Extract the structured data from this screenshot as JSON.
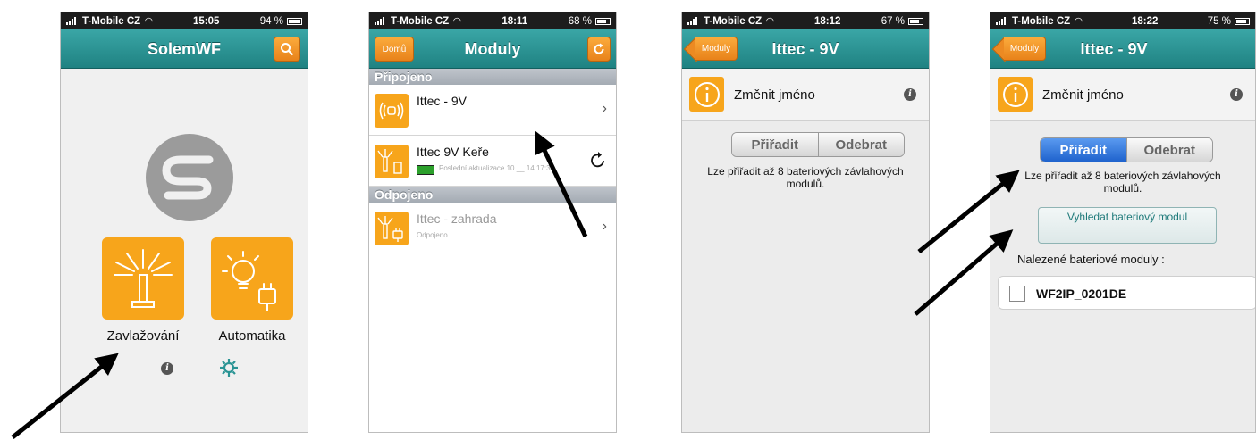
{
  "screens": [
    {
      "status": {
        "carrier": "T-Mobile CZ",
        "time": "15:05",
        "battery": "94 %"
      },
      "nav": {
        "title": "SolemWF"
      },
      "tiles": [
        {
          "label": "Zavlažování"
        },
        {
          "label": "Automatika"
        }
      ]
    },
    {
      "status": {
        "carrier": "T-Mobile CZ",
        "time": "18:11",
        "battery": "68 %"
      },
      "nav": {
        "title": "Moduly",
        "left_button": "Domů"
      },
      "sections": [
        {
          "title": "Připojeno",
          "items": [
            {
              "name": "Ittec - 9V",
              "sub": ""
            },
            {
              "name": "Ittec 9V Keře",
              "sub": "Poslední aktualizace 10.__.14 17:33"
            }
          ]
        },
        {
          "title": "Odpojeno",
          "items": [
            {
              "name": "Ittec - zahrada",
              "sub": "Odpojeno"
            }
          ]
        }
      ]
    },
    {
      "status": {
        "carrier": "T-Mobile CZ",
        "time": "18:12",
        "battery": "67 %"
      },
      "nav": {
        "title": "Ittec - 9V",
        "back_button": "Moduly"
      },
      "rename_label": "Změnit jméno",
      "segment": {
        "assign": "Přiřadit",
        "remove": "Odebrat"
      },
      "description": "Lze přiřadit až 8 bateriových závlahových modulů."
    },
    {
      "status": {
        "carrier": "T-Mobile CZ",
        "time": "18:22",
        "battery": "75 %"
      },
      "nav": {
        "title": "Ittec - 9V",
        "back_button": "Moduly"
      },
      "rename_label": "Změnit jméno",
      "segment": {
        "assign": "Přiřadit",
        "remove": "Odebrat"
      },
      "description": "Lze přiřadit až 8 bateriových závlahových modulů.",
      "search_button": "Vyhledat bateriový modul",
      "found_label": "Nalezené bateriové moduly :",
      "found_items": [
        {
          "name": "WF2IP_0201DE"
        }
      ]
    }
  ],
  "colors": {
    "teal": "#2a9494",
    "orange": "#f7a51b",
    "blue": "#2d72d9"
  }
}
